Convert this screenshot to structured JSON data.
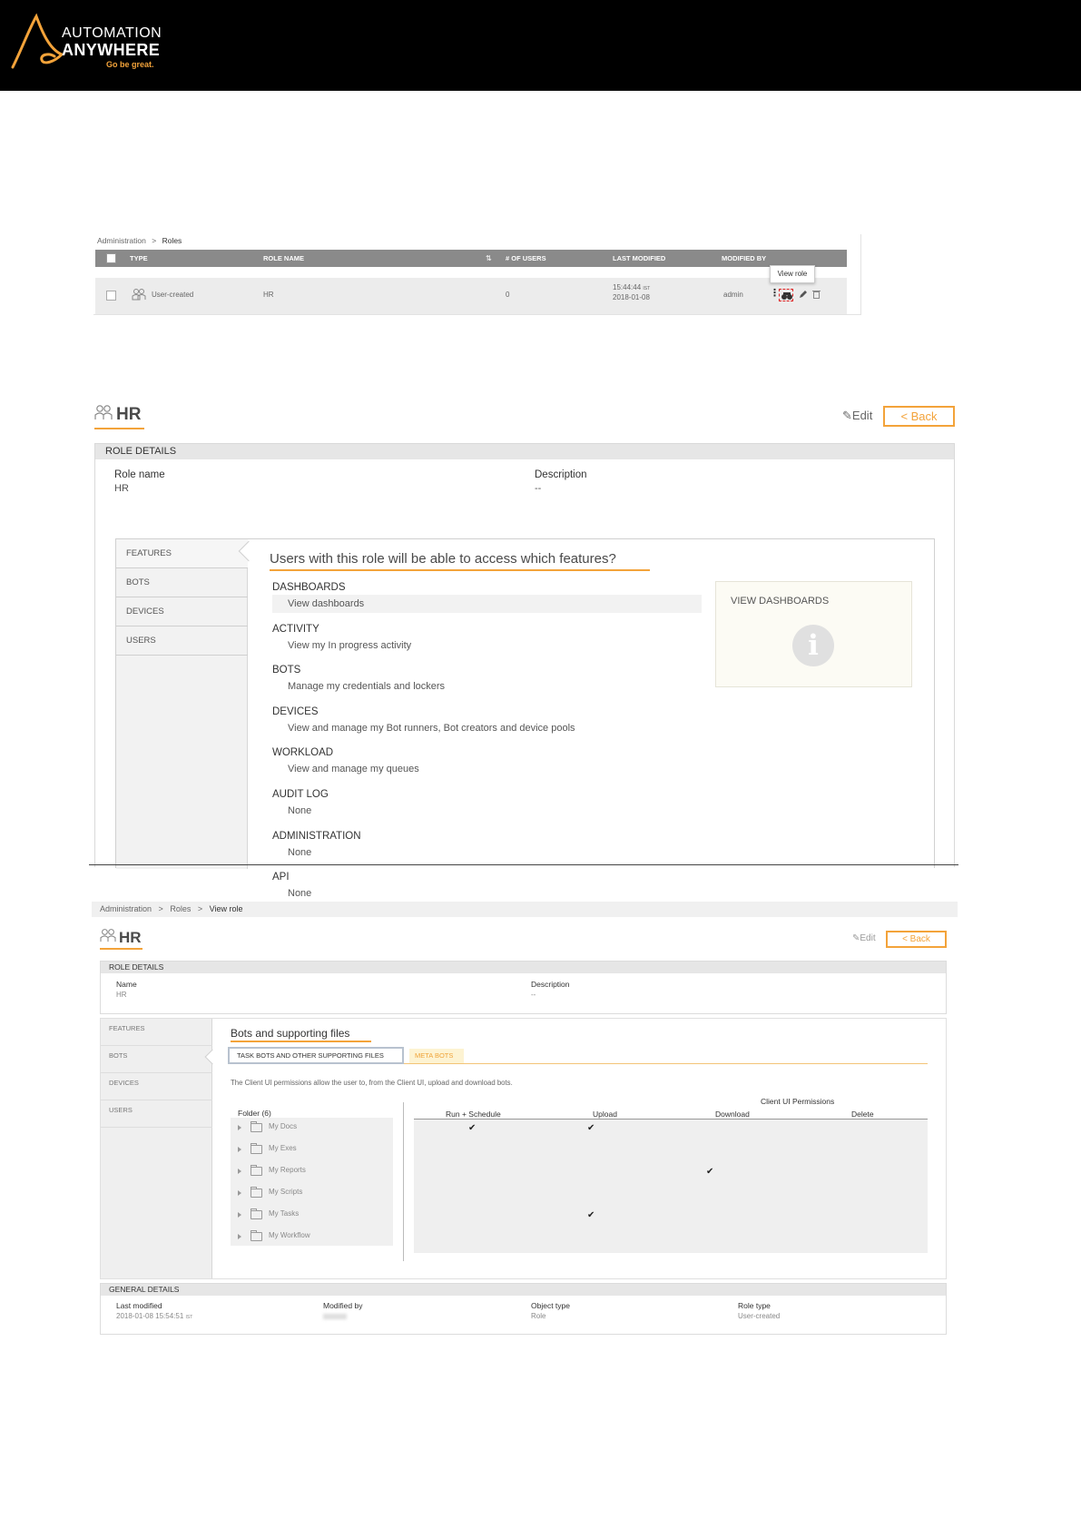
{
  "brand": {
    "line1": "AUTOMATION",
    "line2": "ANYWHERE",
    "tagline": "Go be great.",
    "accent_color": "#f3a33a"
  },
  "roles_list": {
    "breadcrumb": {
      "root": "Administration",
      "sep": ">",
      "current": "Roles"
    },
    "columns": {
      "type": "TYPE",
      "role_name": "ROLE NAME",
      "users": "# OF USERS",
      "last_modified": "LAST MODIFIED",
      "modified_by": "MODIFIED BY"
    },
    "sort_icon": "⇅",
    "row": {
      "type": "User-created",
      "role_name": "HR",
      "users": "0",
      "time": "15:44:44",
      "tz": "IST",
      "date": "2018-01-08",
      "modified_by": "admin"
    },
    "tooltip": "View role",
    "icons": [
      "users-icon",
      "more-icon",
      "view-role-icon",
      "edit-icon",
      "delete-icon"
    ]
  },
  "features_view": {
    "title": "HR",
    "edit_label": "Edit",
    "back_label": "< Back",
    "section_title": "ROLE DETAILS",
    "role_name_label": "Role name",
    "role_name_value": "HR",
    "description_label": "Description",
    "description_value": "--",
    "nav": [
      "FEATURES",
      "BOTS",
      "DEVICES",
      "USERS"
    ],
    "heading": "Users with this role will be able to access which features?",
    "categories": [
      {
        "name": "DASHBOARDS",
        "item": "View dashboards"
      },
      {
        "name": "ACTIVITY",
        "item": "View my In progress activity"
      },
      {
        "name": "BOTS",
        "item": "Manage my credentials and lockers"
      },
      {
        "name": "DEVICES",
        "item": "View and manage my Bot runners, Bot creators and device pools"
      },
      {
        "name": "WORKLOAD",
        "item": "View and manage my queues"
      },
      {
        "name": "AUDIT LOG",
        "item": "None"
      },
      {
        "name": "ADMINISTRATION",
        "item": "None"
      },
      {
        "name": "API",
        "item": "None"
      }
    ],
    "info_box": {
      "label": "VIEW DASHBOARDS",
      "icon": "i"
    }
  },
  "bots_view": {
    "breadcrumb": {
      "root": "Administration",
      "mid": "Roles",
      "current": "View role"
    },
    "title": "HR",
    "edit_label": "Edit",
    "back_label": "< Back",
    "section_title": "ROLE DETAILS",
    "name_label": "Name",
    "name_value": "HR",
    "description_label": "Description",
    "description_value": "--",
    "nav": [
      "FEATURES",
      "BOTS",
      "DEVICES",
      "USERS"
    ],
    "heading": "Bots and supporting files",
    "tabs": [
      "TASK BOTS AND OTHER SUPPORTING FILES",
      "META BOTS"
    ],
    "description": "The Client UI permissions allow the user to, from the Client UI, upload and download bots.",
    "folder_header": "Folder (6)",
    "permissions_title": "Client UI Permissions",
    "permission_columns": [
      "Run + Schedule",
      "Upload",
      "Download",
      "Delete"
    ],
    "folders": [
      "My Docs",
      "My Exes",
      "My Reports",
      "My Scripts",
      "My Tasks",
      "My Workflow"
    ],
    "checkmark": "✔",
    "general": {
      "section_title": "GENERAL DETAILS",
      "last_modified_label": "Last modified",
      "last_modified_value": "2018-01-08 15:54:51",
      "last_modified_tz": "IST",
      "modified_by_label": "Modified by",
      "object_type_label": "Object type",
      "object_type_value": "Role",
      "role_type_label": "Role type",
      "role_type_value": "User-created"
    }
  }
}
